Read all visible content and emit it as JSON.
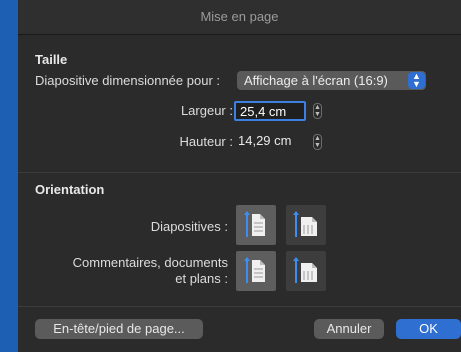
{
  "window": {
    "title": "Mise en page"
  },
  "size": {
    "section_title": "Taille",
    "fit_label": "Diapositive dimensionnée pour :",
    "fit_value": "Affichage à l'écran (16:9)",
    "width_label": "Largeur :",
    "width_value": "25,4 cm",
    "height_label": "Hauteur :",
    "height_value": "14,29 cm"
  },
  "orientation": {
    "section_title": "Orientation",
    "slides_label": "Diapositives :",
    "notes_label_line1": "Commentaires, documents",
    "notes_label_line2": "et plans :"
  },
  "buttons": {
    "header_footer": "En-tête/pied de page...",
    "cancel": "Annuler",
    "ok": "OK"
  },
  "colors": {
    "accent": "#2f6fd1",
    "background": "#2b2b2b"
  },
  "icons": {
    "portrait": "portrait-orientation-icon",
    "landscape": "landscape-orientation-icon"
  }
}
